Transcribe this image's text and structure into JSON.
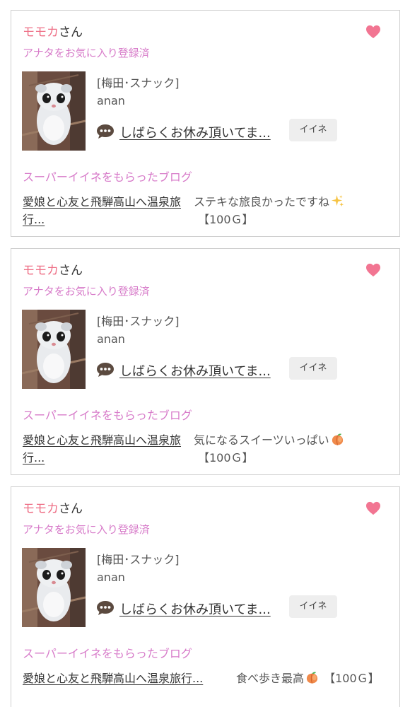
{
  "colors": {
    "name_pink": "#ee6f86",
    "accent_orchid": "#d77bc9",
    "heart_pink": "#f27592",
    "border": "#cfcfcf",
    "button_bg": "#eeeeee"
  },
  "cards": [
    {
      "name": "モモカ",
      "honorific": "さん",
      "favorite_status": "アナタをお気に入り登録済",
      "favorite_icon": "heart-icon",
      "area": "[梅田･スナック]",
      "shop": "anan",
      "status_icon": "speech-bubble-icon",
      "status_message": "しばらくお休み頂いてま...",
      "iine_label": "イイネ",
      "blog_heading": "スーパーイイネをもらったブログ",
      "blog_title": "愛娘と心友と飛騨高山へ温泉旅行...",
      "comment": "ステキな旅良かったですね",
      "comment_emoji": "sparkles-icon",
      "price": "【100Ｇ】"
    },
    {
      "name": "モモカ",
      "honorific": "さん",
      "favorite_status": "アナタをお気に入り登録済",
      "favorite_icon": "heart-icon",
      "area": "[梅田･スナック]",
      "shop": "anan",
      "status_icon": "speech-bubble-icon",
      "status_message": "しばらくお休み頂いてま...",
      "iine_label": "イイネ",
      "blog_heading": "スーパーイイネをもらったブログ",
      "blog_title": "愛娘と心友と飛騨高山へ温泉旅行...",
      "comment": "気になるスイーツいっぱい",
      "comment_emoji": "peach-icon",
      "price": "【100Ｇ】"
    },
    {
      "name": "モモカ",
      "honorific": "さん",
      "favorite_status": "アナタをお気に入り登録済",
      "favorite_icon": "heart-icon",
      "area": "[梅田･スナック]",
      "shop": "anan",
      "status_icon": "speech-bubble-icon",
      "status_message": "しばらくお休み頂いてま...",
      "iine_label": "イイネ",
      "blog_heading": "スーパーイイネをもらったブログ",
      "blog_title": "愛娘と心友と飛騨高山へ温泉旅行...",
      "comment": "食べ歩き最高",
      "comment_emoji": "peach-icon",
      "price": "【100Ｇ】"
    }
  ]
}
